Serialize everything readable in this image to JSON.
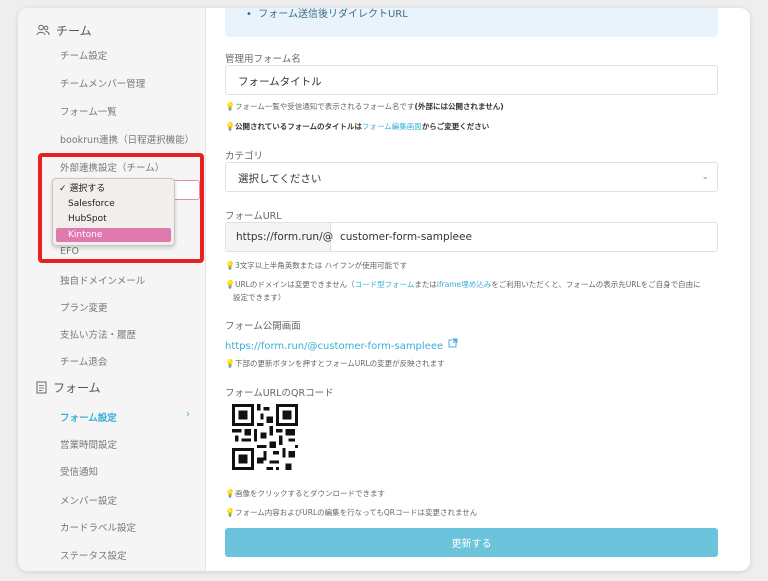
{
  "sidebar": {
    "team_section": {
      "label": "チーム",
      "icon": "team-icon"
    },
    "team_items": [
      "チーム設定",
      "チームメンバー管理",
      "フォーム一覧",
      "bookrun連携（日程選択機能）",
      "外部連携設定（チーム）",
      "EFO",
      "独自ドメインメール",
      "プラン変更",
      "支払い方法・履歴",
      "チーム退会"
    ],
    "form_section": {
      "label": "フォーム",
      "icon": "document-icon"
    },
    "form_items": [
      "フォーム設定",
      "営業時間設定",
      "受信通知",
      "メンバー設定",
      "カードラベル設定",
      "ステータス設定"
    ],
    "active_item": "フォーム設定",
    "chevron": "›"
  },
  "dropdown": {
    "options": [
      "選択する",
      "Salesforce",
      "HubSpot",
      "Kintone"
    ],
    "selected": "選択する",
    "highlighted": "Kintone",
    "check": "✓",
    "highlight_color": "#e07aae"
  },
  "main": {
    "banner_text": "フォーム送信後リダイレクトURL",
    "form_name": {
      "label": "管理用フォーム名",
      "value": "フォームタイトル",
      "hint1": "フォーム一覧や受信通知で表示されるフォーム名です",
      "hint1_bold": "(外部には公開されません)",
      "hint2_pre": "公開されているフォームのタイトルは",
      "hint2_link": "フォーム編集画面",
      "hint2_post": "からご変更ください"
    },
    "category": {
      "label": "カテゴリ",
      "value": "選択してください",
      "arrow": "⌄"
    },
    "form_url": {
      "label": "フォームURL",
      "prefix": "https://form.run/@",
      "value": "customer-form-sampleee",
      "hint1": "3文字以上半角英数または ハイフンが使用可能です",
      "hint2_pre": "URLのドメインは変更できません（",
      "hint2_link1": "コード型フォーム",
      "hint2_mid": "または",
      "hint2_link2": "iframe埋め込み",
      "hint2_post": "をご利用いただくと、フォームの表示先URLをご自身で自由に",
      "hint2_line2": "設定できます）"
    },
    "public_page": {
      "label": "フォーム公開画面",
      "link": "https://form.run/@customer-form-sampleee",
      "icon": "external-link-icon",
      "hint": "下部の更新ボタンを押すとフォームURLの変更が反映されます"
    },
    "qr": {
      "label": "フォームURLのQRコード",
      "hint1": "画像をクリックするとダウンロードできます",
      "hint2": "フォーム内容およびURLの編集を行なってもQRコードは変更されません"
    },
    "update_button": "更新する",
    "bulb": "💡"
  }
}
